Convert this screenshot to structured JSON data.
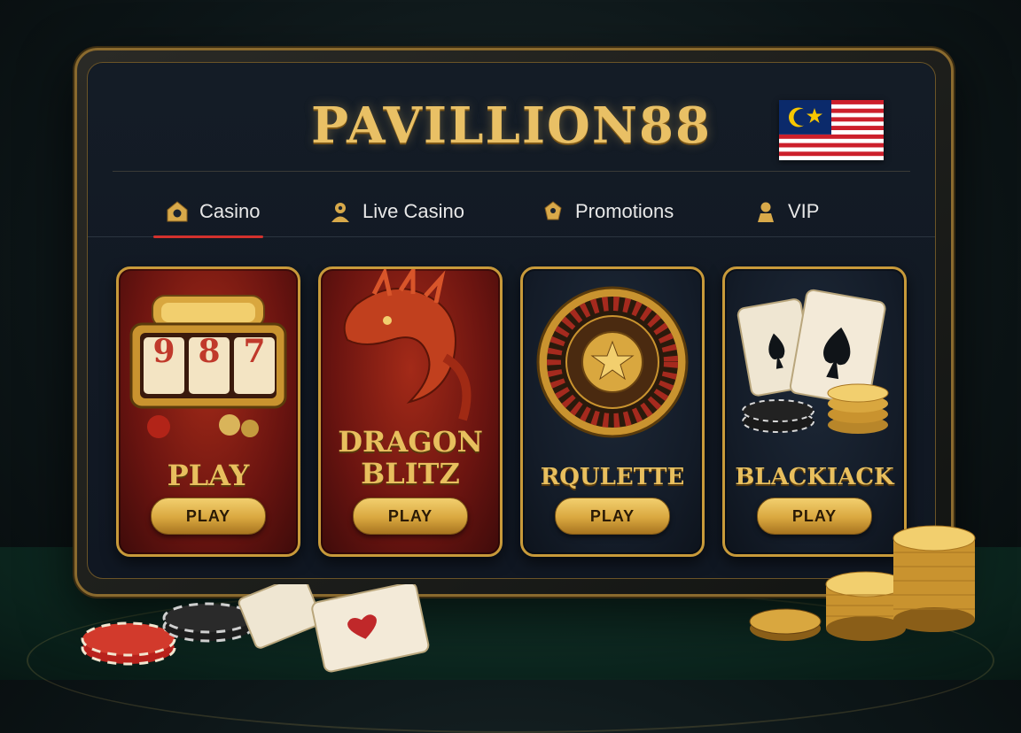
{
  "brand": {
    "name": "PAVILLION88"
  },
  "flag": {
    "country": "Malaysia",
    "icon": "malaysia-flag-icon"
  },
  "nav": {
    "items": [
      {
        "label": "Casino",
        "icon": "house-icon",
        "active": true
      },
      {
        "label": "Live Casino",
        "icon": "dealer-icon",
        "active": false
      },
      {
        "label": "Promotions",
        "icon": "gift-icon",
        "active": false
      },
      {
        "label": "VIP",
        "icon": "person-icon",
        "active": false
      }
    ]
  },
  "games": [
    {
      "title": "PLAY",
      "button": "PLAY",
      "art": "slot-machine-icon",
      "reels": [
        "9",
        "8",
        "7"
      ]
    },
    {
      "title_line1": "DRAGON",
      "title_line2": "BLITZ",
      "button": "PLAY",
      "art": "dragon-icon"
    },
    {
      "title": "RQULETTE",
      "button": "PLAY",
      "art": "roulette-wheel-icon"
    },
    {
      "title": "BLACKIACK",
      "button": "PLAY",
      "art": "cards-and-chips-icon"
    }
  ],
  "colors": {
    "gold": "#e9c065",
    "accent_red": "#d3312d",
    "screen_bg": "#141c26",
    "tile_red": "#6a1410"
  }
}
